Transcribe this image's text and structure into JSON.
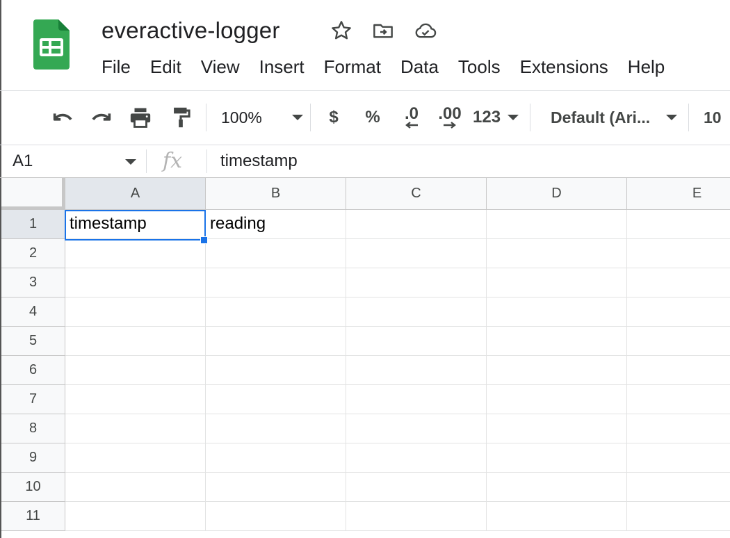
{
  "app": {
    "title": "everactive-logger",
    "logo_icon": "google-sheets-logo",
    "brand_color": "#34a853",
    "selection_color": "#1a73e8"
  },
  "menu": [
    "File",
    "Edit",
    "View",
    "Insert",
    "Format",
    "Data",
    "Tools",
    "Extensions",
    "Help"
  ],
  "toolbar": {
    "zoom": "100%",
    "currency": "$",
    "percent": "%",
    "decrease_decimal": ".0",
    "increase_decimal": ".00",
    "more_formats": "123",
    "font": "Default (Ari...",
    "font_size": "10"
  },
  "formula_bar": {
    "name_box": "A1",
    "fx_label": "fx",
    "value": "timestamp"
  },
  "grid": {
    "columns": [
      "A",
      "B",
      "C",
      "D",
      "E"
    ],
    "rows": [
      "1",
      "2",
      "3",
      "4",
      "5",
      "6",
      "7",
      "8",
      "9",
      "10",
      "11"
    ],
    "cells": {
      "A1": "timestamp",
      "B1": "reading"
    },
    "selected_cell": "A1"
  }
}
